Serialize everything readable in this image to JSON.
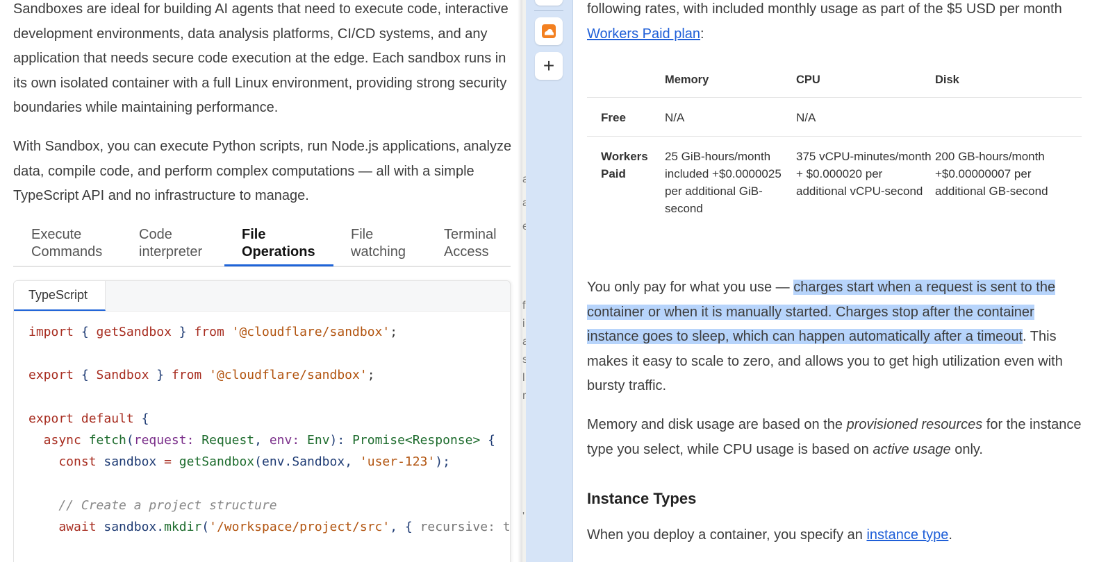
{
  "left": {
    "para1": "Sandboxes are ideal for building AI agents that need to execute code, interactive development environments, data analysis platforms, CI/CD systems, and any application that needs secure code execution at the edge. Each sandbox runs in its own isolated container with a full Linux environment, providing strong security boundaries while maintaining performance.",
    "para2": "With Sandbox, you can execute Python scripts, run Node.js applications, analyze data, compile code, and perform complex computations — all with a simple TypeScript API and no infrastructure to manage.",
    "tabs": [
      {
        "line1": "Execute",
        "line2": "Commands"
      },
      {
        "line1": "Code",
        "line2": "interpreter"
      },
      {
        "line1": "File",
        "line2": "Operations"
      },
      {
        "line1": "File",
        "line2": "watching"
      },
      {
        "line1": "Terminal",
        "line2": "Access"
      }
    ],
    "code_tab": "TypeScript",
    "code": {
      "l1_import": "import",
      "l1_b1": " { ",
      "l1_name": "getSandbox",
      "l1_b2": " } ",
      "l1_from": "from",
      "l1_str": " '@cloudflare/sandbox'",
      "l1_end": ";",
      "l3_export": "export",
      "l3_b1": " { ",
      "l3_name": "Sandbox",
      "l3_b2": " } ",
      "l3_from": "from",
      "l3_str": " '@cloudflare/sandbox'",
      "l3_end": ";",
      "l5_export": "export",
      "l5_default": " default",
      "l5_brace": " {",
      "l6_async": "  async",
      "l6_fetch": " fetch",
      "l6_p1": "(",
      "l6_request": "request",
      "l6_c1": ": ",
      "l6_Request": "Request",
      "l6_comma": ", ",
      "l6_env": "env",
      "l6_c2": ": ",
      "l6_Env": "Env",
      "l6_p2": "): ",
      "l6_Promise": "Promise<Response>",
      "l6_brace": " {",
      "l7_const": "    const",
      "l7_sandbox": " sandbox",
      "l7_eq": " = ",
      "l7_get": "getSandbox",
      "l7_p1": "(",
      "l7_env": "env.Sandbox",
      "l7_comma": ", ",
      "l7_str": "'user-123'",
      "l7_end": ");",
      "l9_comment": "    // Create a project structure",
      "l10_await": "    await",
      "l10_sandbox": " sandbox",
      "l10_dot": ".",
      "l10_mkdir": "mkdir",
      "l10_p1": "(",
      "l10_str": "'/workspace/project/src'",
      "l10_comma": ", { ",
      "l10_rec": "recursive: t"
    }
  },
  "peek_letters": [
    "a",
    "a",
    "e",
    "f",
    "i",
    "a",
    "s",
    "l",
    "r",
    "'"
  ],
  "sidebar": {
    "add_label": "+"
  },
  "right": {
    "intro_before": "following rates, with included monthly usage as part of the $5 USD per month ",
    "intro_link": "Workers Paid plan",
    "intro_after": ":",
    "table": {
      "headers": [
        "",
        "Memory",
        "CPU",
        "Disk"
      ],
      "rows": [
        {
          "label": "Free",
          "memory": "N/A",
          "cpu": "N/A",
          "disk": ""
        },
        {
          "label": "Workers Paid",
          "memory": "25 GiB-hours/month included +$0.0000025 per additional GiB-second",
          "cpu": "375 vCPU-minutes/month + $0.000020 per additional vCPU-second",
          "disk": "200 GB-hours/month +$0.00000007 per additional GB-second"
        }
      ]
    },
    "pay_before": "You only pay for what you use — ",
    "pay_highlight": "charges start when a request is sent to the container or when it is manually started. Charges stop after the container instance goes to sleep, which can happen automatically after a timeout",
    "pay_after": ". This makes it easy to scale to zero, and allows you to get high utilization even with bursty traffic.",
    "mem_before": "Memory and disk usage are based on the ",
    "mem_em1": "provisioned resources",
    "mem_mid": " for the instance type you select, while CPU usage is based on ",
    "mem_em2": "active usage",
    "mem_after": " only.",
    "heading": "Instance Types",
    "deploy_before": "When you deploy a container, you specify an ",
    "deploy_link": "instance type",
    "deploy_after": "."
  }
}
